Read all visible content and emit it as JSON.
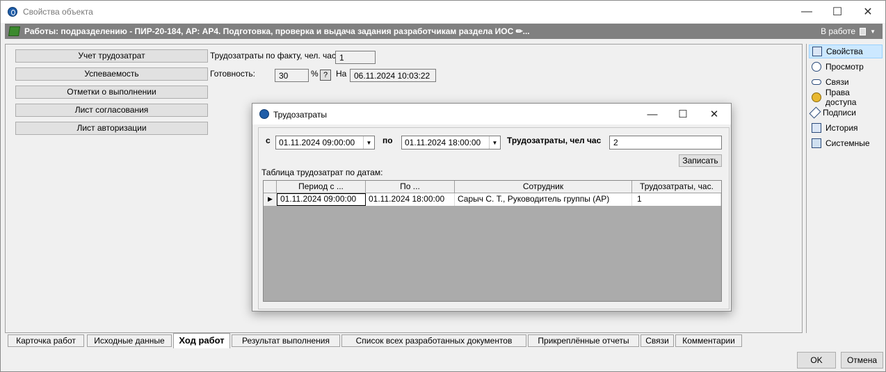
{
  "window": {
    "title": "Свойства объекта"
  },
  "object_bar": {
    "title": "Работы: подразделению - ПИР-20-184, АР: АР4. Подготовка, проверка и выдача задания разработчикам раздела ИОС ✏...",
    "status": "В работе"
  },
  "left_buttons": [
    "Учет трудозатрат",
    "Успеваемость",
    "Отметки о выполнении",
    "Лист согласования",
    "Лист авторизации"
  ],
  "fields": {
    "labor_label": "Трудозатраты по факту, чел. час",
    "labor_value": "1",
    "readiness_label": "Готовность:",
    "readiness_value": "30",
    "percent": "%",
    "help": "?",
    "on_label": "На",
    "on_value": "06.11.2024 10:03:22"
  },
  "right_panel": [
    {
      "label": "Свойства",
      "icon": "properties-icon",
      "selected": true
    },
    {
      "label": "Просмотр",
      "icon": "magnifier-icon",
      "selected": false
    },
    {
      "label": "Связи",
      "icon": "link-icon",
      "selected": false
    },
    {
      "label": "Права доступа",
      "icon": "key-icon",
      "selected": false
    },
    {
      "label": "Подписи",
      "icon": "pen-icon",
      "selected": false
    },
    {
      "label": "История",
      "icon": "history-icon",
      "selected": false
    },
    {
      "label": "Системные",
      "icon": "system-icon",
      "selected": false
    }
  ],
  "tabs": [
    {
      "label": "Карточка работ",
      "active": false
    },
    {
      "label": "Исходные данные",
      "active": false
    },
    {
      "label": "Ход работ",
      "active": true
    },
    {
      "label": "Результат выполнения",
      "active": false
    },
    {
      "label": "Список всех разработанных документов",
      "active": false
    },
    {
      "label": "Прикреплённые отчеты",
      "active": false
    },
    {
      "label": "Связи",
      "active": false
    },
    {
      "label": "Комментарии",
      "active": false
    }
  ],
  "buttons": {
    "ok": "OK",
    "cancel": "Отмена"
  },
  "dialog": {
    "title": "Трудозатраты",
    "from_label": "с",
    "from_value": "01.11.2024 09:00:00",
    "to_label": "по",
    "to_value": "01.11.2024 18:00:00",
    "labor_label": "Трудозатраты, чел час",
    "labor_value": "2",
    "save_button": "Записать",
    "table_label": "Таблица трудозатрат по датам:",
    "columns": [
      "Период с ...",
      "По ...",
      "Сотрудник",
      "Трудозатраты, час."
    ],
    "rows": [
      [
        "01.11.2024 09:00:00",
        "01.11.2024 18:00:00",
        "Сарыч С. Т., Руководитель группы (АР)",
        "1"
      ]
    ]
  }
}
